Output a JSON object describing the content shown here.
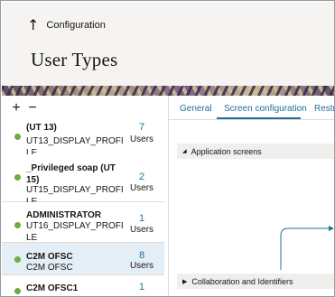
{
  "header": {
    "back_label": "Configuration",
    "page_title": "User Types"
  },
  "toolbar": {
    "add_label": "+",
    "remove_label": "−"
  },
  "user_types": [
    {
      "name": "(UT 13)",
      "profile": "UT13_DISPLAY_PROFILE",
      "count": "7",
      "unit": "Users",
      "status": "active",
      "selected": false
    },
    {
      "name": "_Privileged soap (UT 15)",
      "profile": "UT15_DISPLAY_PROFILE",
      "count": "2",
      "unit": "Users",
      "status": "active",
      "selected": false
    },
    {
      "name": "ADMINISTRATOR",
      "profile": "UT16_DISPLAY_PROFILE",
      "count": "1",
      "unit": "Users",
      "status": "active",
      "selected": false
    },
    {
      "name": "C2M OFSC",
      "profile": "C2M OFSC",
      "count": "8",
      "unit": "Users",
      "status": "active",
      "selected": true
    },
    {
      "name": "C2M OFSC1",
      "profile": "",
      "count": "1",
      "unit": "",
      "status": "active",
      "selected": false
    }
  ],
  "tabs": [
    {
      "label": "General",
      "active": false
    },
    {
      "label": "Screen configuration",
      "active": true
    },
    {
      "label": "Restri",
      "active": false
    }
  ],
  "sections": {
    "application_screens": "Application screens",
    "collaboration": "Collaboration and Identifiers"
  },
  "colors": {
    "accent": "#227099",
    "status_active": "#6aad42",
    "selected_row": "#e4eef6",
    "header_bg": "#f6f4f2"
  }
}
